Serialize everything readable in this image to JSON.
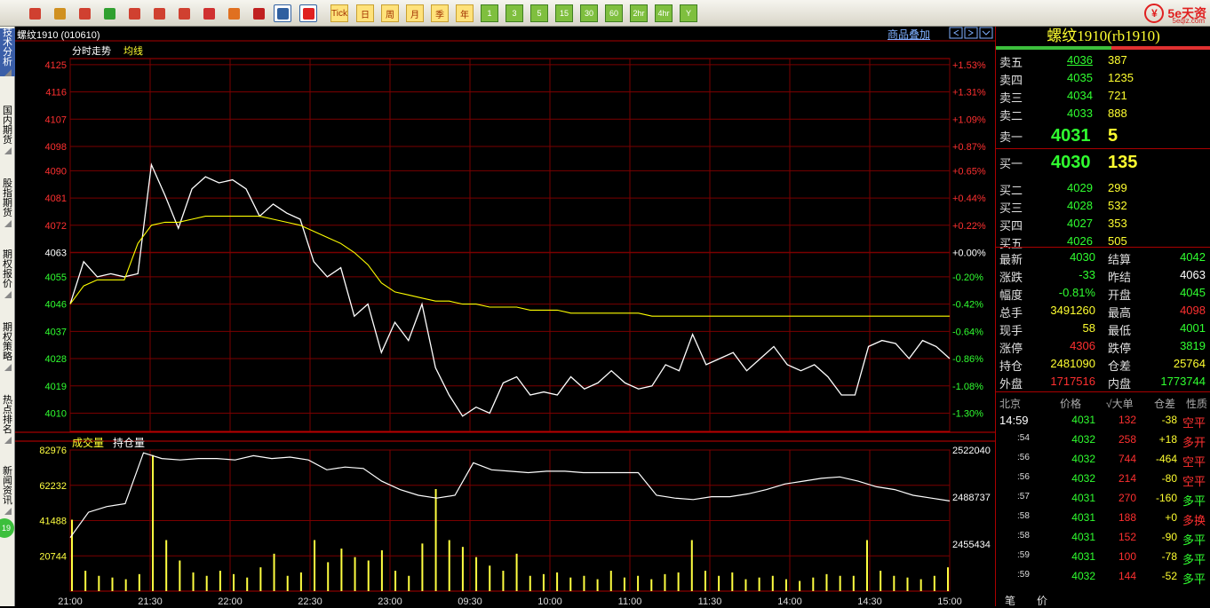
{
  "toolbar": {
    "period_buttons": [
      "Tick",
      "日",
      "周",
      "月",
      "季",
      "年",
      "1",
      "3",
      "5",
      "15",
      "30",
      "60",
      "2hr",
      "4hr",
      "Y"
    ],
    "icons": [
      "home-icon",
      "notebook-icon",
      "folder-icon",
      "refresh-icon",
      "zoom-in-icon",
      "zoom-out-icon",
      "window-icon",
      "pen-icon",
      "tool-icon",
      "filter-icon",
      "table-icon",
      "chart-icon"
    ]
  },
  "logo": {
    "text": "5e天资",
    "site": "5eqiz.com",
    "mark": "¥"
  },
  "left_tabs": [
    "技术分析",
    "国内期货",
    "股指期货",
    "期权报价",
    "期权策略",
    "热点排名",
    "新闻资讯"
  ],
  "left_badge": "19",
  "chart": {
    "instrument_title": "螺纹1910 (010610)",
    "overlay_link": "商品叠加",
    "nav_icons": [
      "nav-prev-icon",
      "nav-next-icon",
      "nav-dropdown-icon"
    ],
    "price_legend": [
      "分时走势",
      "均线"
    ],
    "volume_legend": [
      "成交量",
      "持仓量"
    ],
    "price_ticks": [
      "4125",
      "4116",
      "4107",
      "4098",
      "4090",
      "4081",
      "4072",
      "4063",
      "4055",
      "4046",
      "4037",
      "4028",
      "4019",
      "4010"
    ],
    "pct_ticks": [
      "+1.53%",
      "+1.31%",
      "+1.09%",
      "+0.87%",
      "+0.65%",
      "+0.44%",
      "+0.22%",
      "+0.00%",
      "-0.20%",
      "-0.42%",
      "-0.64%",
      "-0.86%",
      "-1.08%",
      "-1.30%"
    ],
    "volume_ticks": [
      "82976",
      "62232",
      "41488",
      "20744"
    ],
    "oi_ticks": [
      "2522040",
      "2488737",
      "2455434"
    ],
    "time_ticks": [
      "21:00",
      "21:30",
      "22:00",
      "22:30",
      "23:00",
      "09:30",
      "10:00",
      "11:00",
      "11:30",
      "14:00",
      "14:30",
      "15:00"
    ],
    "colors": {
      "price_line": "#ffffff",
      "avg_line": "#ffff00",
      "grid": "#880000",
      "up": "#ff3030",
      "down": "#30ff30",
      "flat": "#ffffff",
      "volume": "#ffff40"
    }
  },
  "panel": {
    "title": "螺纹1910(rb1910)",
    "asks": [
      {
        "label": "卖五",
        "price": "4036",
        "vol": "387"
      },
      {
        "label": "卖四",
        "price": "4035",
        "vol": "1235"
      },
      {
        "label": "卖三",
        "price": "4034",
        "vol": "721"
      },
      {
        "label": "卖二",
        "price": "4033",
        "vol": "888"
      },
      {
        "label": "卖一",
        "price": "4031",
        "vol": "5"
      }
    ],
    "bids": [
      {
        "label": "买一",
        "price": "4030",
        "vol": "135"
      },
      {
        "label": "买二",
        "price": "4029",
        "vol": "299"
      },
      {
        "label": "买三",
        "price": "4028",
        "vol": "532"
      },
      {
        "label": "买四",
        "price": "4027",
        "vol": "353"
      },
      {
        "label": "买五",
        "price": "4026",
        "vol": "505"
      }
    ],
    "stats": [
      {
        "l1": "最新",
        "v1": "4030",
        "c1": "g",
        "l2": "结算",
        "v2": "4042",
        "c2": "g"
      },
      {
        "l1": "涨跌",
        "v1": "-33",
        "c1": "g",
        "l2": "昨结",
        "v2": "4063",
        "c2": "w"
      },
      {
        "l1": "幅度",
        "v1": "-0.81%",
        "c1": "g",
        "l2": "开盘",
        "v2": "4045",
        "c2": "g"
      },
      {
        "l1": "总手",
        "v1": "3491260",
        "c1": "y",
        "l2": "最高",
        "v2": "4098",
        "c2": "r"
      },
      {
        "l1": "现手",
        "v1": "58",
        "c1": "y",
        "l2": "最低",
        "v2": "4001",
        "c2": "g"
      },
      {
        "l1": "涨停",
        "v1": "4306",
        "c1": "r",
        "l2": "跌停",
        "v2": "3819",
        "c2": "g"
      },
      {
        "l1": "持仓",
        "v1": "2481090",
        "c1": "y",
        "l2": "仓差",
        "v2": "25764",
        "c2": "y"
      },
      {
        "l1": "外盘",
        "v1": "1717516",
        "c1": "r",
        "l2": "内盘",
        "v2": "1773744",
        "c2": "g"
      }
    ],
    "ticks_header": [
      "北京",
      "价格",
      "√大单",
      "仓差",
      "性质"
    ],
    "ticks": [
      {
        "t": "14:59",
        "p": "4031",
        "v": "132",
        "oi": "-38",
        "n": "空平",
        "nc": "r"
      },
      {
        "t": ":54",
        "p": "4032",
        "v": "258",
        "oi": "+18",
        "n": "多开",
        "nc": "r"
      },
      {
        "t": ":56",
        "p": "4032",
        "v": "744",
        "oi": "-464",
        "n": "空平",
        "nc": "r"
      },
      {
        "t": ":56",
        "p": "4032",
        "v": "214",
        "oi": "-80",
        "n": "空平",
        "nc": "r"
      },
      {
        "t": ":57",
        "p": "4031",
        "v": "270",
        "oi": "-160",
        "n": "多平",
        "nc": "g"
      },
      {
        "t": ":58",
        "p": "4031",
        "v": "188",
        "oi": "+0",
        "n": "多换",
        "nc": "r"
      },
      {
        "t": ":58",
        "p": "4031",
        "v": "152",
        "oi": "-90",
        "n": "多平",
        "nc": "g"
      },
      {
        "t": ":59",
        "p": "4031",
        "v": "100",
        "oi": "-78",
        "n": "多平",
        "nc": "g"
      },
      {
        "t": ":59",
        "p": "4032",
        "v": "144",
        "oi": "-52",
        "n": "多平",
        "nc": "g"
      }
    ],
    "bottom_tabs": [
      "笔",
      "价"
    ]
  },
  "chart_data": {
    "type": "line",
    "title": "螺纹1910 (010610)",
    "x_ticks": [
      "21:00",
      "21:30",
      "22:00",
      "22:30",
      "23:00",
      "09:30",
      "10:00",
      "11:00",
      "11:30",
      "14:00",
      "14:30",
      "15:00"
    ],
    "prev_settle": 4063,
    "ylim": [
      4004,
      4127
    ],
    "series": [
      {
        "name": "分时走势",
        "values": [
          4046,
          4060,
          4055,
          4056,
          4055,
          4056,
          4092,
          4082,
          4071,
          4084,
          4088,
          4086,
          4087,
          4084,
          4075,
          4079,
          4076,
          4074,
          4060,
          4055,
          4058,
          4042,
          4046,
          4030,
          4040,
          4034,
          4046,
          4025,
          4016,
          4009,
          4012,
          4010,
          4020,
          4022,
          4016,
          4017,
          4016,
          4022,
          4018,
          4020,
          4024,
          4020,
          4018,
          4019,
          4026,
          4024,
          4036,
          4026,
          4028,
          4030,
          4024,
          4028,
          4032,
          4026,
          4024,
          4026,
          4022,
          4016,
          4016,
          4032,
          4034,
          4033,
          4028,
          4034,
          4032,
          4028
        ]
      },
      {
        "name": "均线",
        "values": [
          4046,
          4052,
          4054,
          4054,
          4054,
          4066,
          4072,
          4073,
          4073,
          4074,
          4075,
          4075,
          4075,
          4075,
          4075,
          4074,
          4073,
          4072,
          4070,
          4068,
          4066,
          4063,
          4059,
          4053,
          4050,
          4049,
          4048,
          4047,
          4047,
          4046,
          4046,
          4045,
          4045,
          4045,
          4044,
          4044,
          4044,
          4043,
          4043,
          4043,
          4043,
          4043,
          4043,
          4042,
          4042,
          4042,
          4042,
          4042,
          4042,
          4042,
          4042,
          4042,
          4042,
          4042,
          4042,
          4042,
          4042,
          4042,
          4042,
          4042,
          4042,
          4042,
          4042,
          4042,
          4042,
          4042
        ]
      }
    ],
    "volume": {
      "name": "成交量",
      "ylim": [
        0,
        82976
      ],
      "values": [
        42000,
        12000,
        9000,
        8000,
        7000,
        10000,
        80000,
        30000,
        18000,
        11000,
        9000,
        12000,
        10000,
        8000,
        14000,
        22000,
        9000,
        11000,
        30000,
        17000,
        25000,
        20000,
        18000,
        24000,
        12000,
        9000,
        28000,
        60000,
        30000,
        26000,
        20000,
        15000,
        12000,
        22000,
        9000,
        10000,
        11000,
        8000,
        9000,
        7000,
        12000,
        8000,
        9000,
        7000,
        10000,
        11000,
        30000,
        12000,
        9000,
        11000,
        7000,
        8000,
        9000,
        7000,
        6000,
        8000,
        10000,
        9000,
        9000,
        30000,
        12000,
        9000,
        8000,
        7000,
        9000,
        14000
      ]
    },
    "open_interest": {
      "name": "持仓量",
      "values": [
        2460000,
        2478000,
        2482000,
        2484000,
        2520000,
        2516000,
        2515000,
        2516000,
        2516000,
        2515000,
        2518000,
        2516000,
        2517000,
        2515000,
        2508000,
        2510000,
        2509000,
        2500000,
        2494000,
        2490000,
        2488000,
        2490000,
        2513000,
        2508000,
        2507000,
        2506000,
        2507000,
        2507000,
        2506000,
        2506000,
        2506000,
        2506000,
        2490000,
        2488000,
        2487000,
        2489000,
        2489000,
        2491000,
        2494000,
        2498000,
        2500000,
        2502000,
        2503000,
        2500000,
        2496000,
        2494000,
        2490000,
        2488000,
        2486000
      ]
    }
  }
}
